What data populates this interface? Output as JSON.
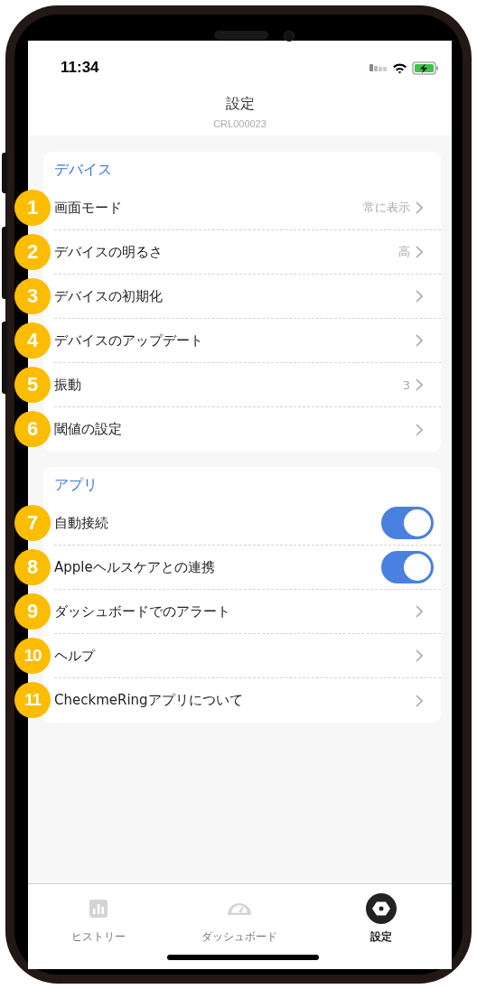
{
  "status_bar": {
    "time": "11:34"
  },
  "header": {
    "title": "設定",
    "subtitle": "CRL000023"
  },
  "sections": [
    {
      "title": "デバイス",
      "rows": [
        {
          "badge": "1",
          "kind": "link",
          "label": "画面モード",
          "value": "常に表示"
        },
        {
          "badge": "2",
          "kind": "link",
          "label": "デバイスの明るさ",
          "value": "高"
        },
        {
          "badge": "3",
          "kind": "link",
          "label": "デバイスの初期化"
        },
        {
          "badge": "4",
          "kind": "link",
          "label": "デバイスのアップデート"
        },
        {
          "badge": "5",
          "kind": "link",
          "label": "振動",
          "value": "3"
        },
        {
          "badge": "6",
          "kind": "link",
          "label": "閾値の設定"
        }
      ]
    },
    {
      "title": "アプリ",
      "rows": [
        {
          "badge": "7",
          "kind": "toggle",
          "label": "自動接続",
          "on": true
        },
        {
          "badge": "8",
          "kind": "toggle",
          "label": "Appleヘルスケアとの連携",
          "on": true
        },
        {
          "badge": "9",
          "kind": "link",
          "label": "ダッシュボードでのアラート"
        },
        {
          "badge": "10",
          "kind": "link",
          "label": "ヘルプ"
        },
        {
          "badge": "11",
          "kind": "link",
          "label": "CheckmeRingアプリについて"
        }
      ]
    }
  ],
  "tab_bar": [
    {
      "label": "ヒストリー",
      "selected": false
    },
    {
      "label": "ダッシュボード",
      "selected": false
    },
    {
      "label": "設定",
      "selected": true
    }
  ]
}
